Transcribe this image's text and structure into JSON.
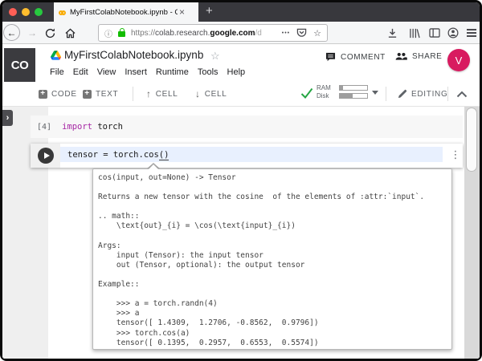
{
  "window": {
    "tab_title": "MyFirstColabNotebook.ipynb - C",
    "close_tab": "×",
    "new_tab": "+"
  },
  "urlbar": {
    "info_icon": "ⓘ",
    "scheme": "https://",
    "subdomain": "colab.research.",
    "domain": "google.com",
    "path": "/d",
    "ellipsis": "•••",
    "bookmark_star": "☆"
  },
  "header": {
    "logo": "CO",
    "title": "MyFirstColabNotebook.ipynb",
    "star": "☆",
    "menus": [
      "File",
      "Edit",
      "View",
      "Insert",
      "Runtime",
      "Tools",
      "Help"
    ],
    "comment_label": "COMMENT",
    "share_label": "SHARE",
    "avatar_initial": "V"
  },
  "toolbar": {
    "plus": "+",
    "code_label": "CODE",
    "text_label": "TEXT",
    "cell_up_arrow": "↑",
    "cell_up_label": "CELL",
    "cell_down_arrow": "↓",
    "cell_down_label": "CELL",
    "ram_label": "RAM",
    "disk_label": "Disk",
    "editing_label": "EDITING"
  },
  "notebook": {
    "drawer_arrow": "›",
    "cell1": {
      "exec_count": "[4]",
      "keyword": "import",
      "code_rest": " torch"
    },
    "cell2": {
      "code_main": "tensor = torch.cos",
      "code_paren": "()",
      "kebab": "⋮"
    },
    "tooltip_docstring": "cos(input, out=None) -> Tensor\n\nReturns a new tensor with the cosine  of the elements of :attr:`input`.\n\n.. math::\n    \\text{out}_{i} = \\cos(\\text{input}_{i})\n\nArgs:\n    input (Tensor): the input tensor\n    out (Tensor, optional): the output tensor\n\nExample::\n\n    >>> a = torch.randn(4)\n    >>> a\n    tensor([ 1.4309,  1.2706, -0.8562,  0.9796])\n    >>> torch.cos(a)\n    tensor([ 0.1395,  0.2957,  0.6553,  0.5574])"
  },
  "colors": {
    "tabbar_dark": "#38383d",
    "lock_green": "#12bc00",
    "check_green": "#26a644",
    "keyword_purple": "#a626a4",
    "current_line_blue": "#e8f0fe",
    "avatar_pink": "#d81b60",
    "favicon_orange": "#f9ab00"
  }
}
